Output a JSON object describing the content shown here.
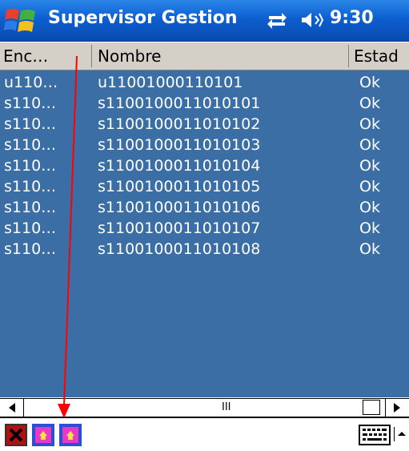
{
  "titlebar": {
    "app_title": "Supervisor Gestion",
    "time": "9:30",
    "start_icon": "windows-start-icon",
    "connectivity_icon": "connectivity-icon",
    "volume_icon": "volume-icon",
    "bg_color": "#0a5ad0"
  },
  "listview": {
    "columns": [
      "Enc…",
      "Nombre",
      "Estad"
    ],
    "rows": [
      {
        "enc": "u110…",
        "nombre": "u11001000110101",
        "estado": "Ok"
      },
      {
        "enc": "s110…",
        "nombre": "s1100100011010101",
        "estado": "Ok"
      },
      {
        "enc": "s110…",
        "nombre": "s1100100011010102",
        "estado": "Ok"
      },
      {
        "enc": "s110…",
        "nombre": "s1100100011010103",
        "estado": "Ok"
      },
      {
        "enc": "s110…",
        "nombre": "s1100100011010104",
        "estado": "Ok"
      },
      {
        "enc": "s110…",
        "nombre": "s1100100011010105",
        "estado": "Ok"
      },
      {
        "enc": "s110…",
        "nombre": "s1100100011010106",
        "estado": "Ok"
      },
      {
        "enc": "s110…",
        "nombre": "s1100100011010107",
        "estado": "Ok"
      },
      {
        "enc": "s110…",
        "nombre": "s1100100011010108",
        "estado": "Ok"
      }
    ],
    "bg_color": "#3a6ea5",
    "text_color": "#ffffff"
  },
  "scrollbar": {
    "thumb_glyph": "III",
    "left_icon": "scroll-left-arrow-icon",
    "right_icon": "scroll-right-arrow-icon"
  },
  "menubar": {
    "buttons": [
      "close-icon",
      "toolbar-image-icon",
      "toolbar-image-icon"
    ],
    "keyboard_icon": "keyboard-icon",
    "input_menu_icon": "chevron-up-icon"
  },
  "annotation": {
    "color": "#ff0000",
    "description_icon": "red-arrow"
  }
}
